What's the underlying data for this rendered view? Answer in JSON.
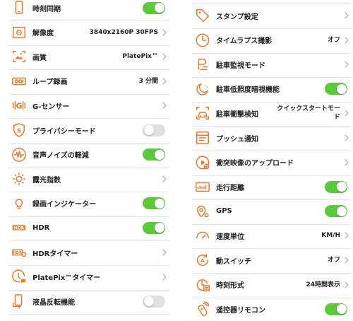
{
  "colors": {
    "accent": "#e8782a",
    "toggle_on": "#5cc93b",
    "toggle_off": "#e1e1e1"
  },
  "left": {
    "rows": [
      {
        "label": "時刻同期",
        "icon": "phone-icon",
        "control": "toggle",
        "on": true
      },
      {
        "label": "解像度",
        "icon": "resolution-icon",
        "value": "3840x2160P 30FPS",
        "control": "chevron"
      },
      {
        "label": "画質",
        "icon": "image-quality-icon",
        "value": "PlatePix™",
        "control": "chevron"
      },
      {
        "label": "ループ録画",
        "icon": "loop-recording-icon",
        "value": "3 分間",
        "control": "chevron"
      },
      {
        "label": "G-センサー",
        "icon": "g-sensor-icon",
        "control": "chevron"
      },
      {
        "label": "プライバシーモード",
        "icon": "privacy-shield-icon",
        "control": "toggle",
        "on": false
      },
      {
        "label": "音声ノイズの軽減",
        "icon": "audio-wave-icon",
        "control": "toggle",
        "on": true
      },
      {
        "label": "露光指数",
        "icon": "sun-icon",
        "control": "chevron"
      },
      {
        "label": "録画インジケーター",
        "icon": "lightbulb-icon",
        "control": "toggle",
        "on": true
      },
      {
        "label": "HDR",
        "icon": "hdr-icon",
        "control": "toggle",
        "on": true
      },
      {
        "label": "HDRタイマー",
        "icon": "hdr-timer-icon",
        "control": "chevron"
      },
      {
        "label": "PlatePix™タイマー",
        "icon": "clock-plate-icon",
        "control": "chevron"
      },
      {
        "label": "液晶反転機能",
        "icon": "screen-flip-icon",
        "control": "toggle",
        "on": false
      }
    ]
  },
  "right": {
    "rows": [
      {
        "label": "スタンプ設定",
        "icon": "tag-icon",
        "control": "chevron"
      },
      {
        "label": "タイムラプス撮影",
        "icon": "clock-icon",
        "value": "オフ",
        "control": "chevron"
      },
      {
        "label": "駐車監視モード",
        "icon": "parking-icon",
        "control": "chevron"
      },
      {
        "label": "駐車低照度暗視機能",
        "icon": "moon-icon",
        "control": "toggle",
        "on": true
      },
      {
        "label": "駐車衝撃検知",
        "icon": "car-impact-icon",
        "value": "クイックスタートモード",
        "control": "chevron"
      },
      {
        "label": "プッシュ通知",
        "icon": "notification-icon",
        "control": "chevron"
      },
      {
        "label": "衝突映像のアップロード",
        "icon": "upload-video-icon",
        "control": "chevron"
      },
      {
        "label": "走行距離",
        "icon": "odometer-icon",
        "control": "toggle",
        "on": true
      },
      {
        "label": "GPS",
        "icon": "gps-icon",
        "control": "toggle",
        "on": true
      },
      {
        "label": "速度単位",
        "icon": "speedometer-icon",
        "value": "KM/H",
        "control": "chevron"
      },
      {
        "label": "動スイッチ",
        "icon": "auto-switch-icon",
        "value": "オフ",
        "control": "chevron"
      },
      {
        "label": "時刻形式",
        "icon": "time-format-icon",
        "value": "24時間表示",
        "control": "chevron"
      },
      {
        "label": "遥控器リモコン",
        "icon": "remote-icon",
        "control": "toggle",
        "on": true
      }
    ]
  }
}
